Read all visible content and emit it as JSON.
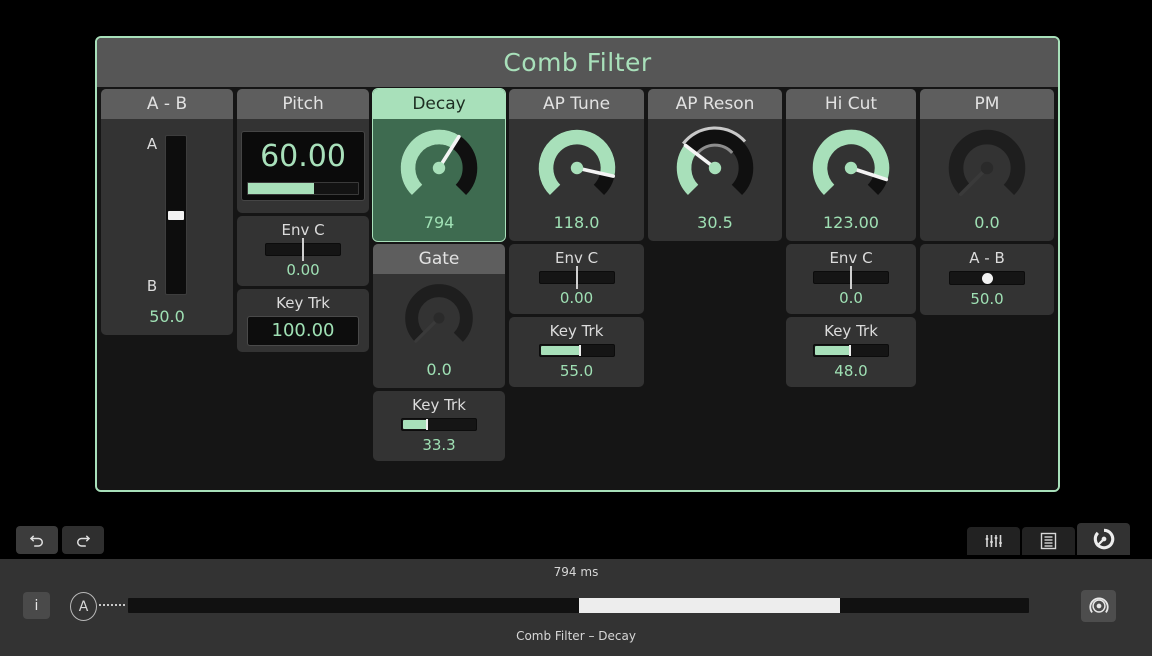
{
  "window": {
    "title": "Comb Filter",
    "accent_color": "#a8e0ba",
    "panel_bg": "#2b2b2b"
  },
  "columns": [
    {
      "id": "a-b",
      "header": "A - B",
      "selected": false,
      "type": "vfader",
      "top_label": "A",
      "bottom_label": "B",
      "value": "50.0",
      "position_pct": 50,
      "subs": []
    },
    {
      "id": "pitch",
      "header": "Pitch",
      "selected": false,
      "type": "display",
      "value": "60.00",
      "bar_pct": 60,
      "subs": [
        {
          "label": "Env C",
          "type": "bipolar",
          "value": "0.00",
          "pct": 50
        },
        {
          "label": "Key Trk",
          "type": "numbox",
          "value": "100.00"
        }
      ]
    },
    {
      "id": "decay",
      "header": "Decay",
      "selected": true,
      "type": "knob",
      "value": "794",
      "knob_pct": 62,
      "mod_pct": null,
      "subs": [
        {
          "label": "Gate",
          "type": "knob_module",
          "value": "0.0",
          "knob_pct": 0
        },
        {
          "label": "Key Trk",
          "type": "bar",
          "value": "33.3",
          "pct": 33.3
        }
      ]
    },
    {
      "id": "ap-tune",
      "header": "AP Tune",
      "selected": false,
      "type": "knob",
      "value": "118.0",
      "knob_pct": 88,
      "mod_pct": null,
      "subs": [
        {
          "label": "Env C",
          "type": "bipolar",
          "value": "0.00",
          "pct": 50
        },
        {
          "label": "Key Trk",
          "type": "bar",
          "value": "55.0",
          "pct": 55
        }
      ]
    },
    {
      "id": "ap-reson",
      "header": "AP Reson",
      "selected": false,
      "type": "knob",
      "value": "30.5",
      "knob_pct": 30.5,
      "mod_pct": 68,
      "subs": []
    },
    {
      "id": "hi-cut",
      "header": "Hi Cut",
      "selected": false,
      "type": "knob",
      "value": "123.00",
      "knob_pct": 90,
      "mod_pct": null,
      "subs": [
        {
          "label": "Env C",
          "type": "bipolar",
          "value": "0.0",
          "pct": 50
        },
        {
          "label": "Key Trk",
          "type": "bar",
          "value": "48.0",
          "pct": 48
        }
      ]
    },
    {
      "id": "pm",
      "header": "PM",
      "selected": false,
      "type": "knob",
      "value": "0.0",
      "knob_pct": 0,
      "knob_dark": true,
      "knob_center": true,
      "mod_pct": null,
      "subs": [
        {
          "label": "A - B",
          "type": "dot",
          "value": "50.0",
          "pct": 50
        }
      ]
    }
  ],
  "toolbar": {
    "undo_icon": "undo-arrow-icon",
    "redo_icon": "redo-arrow-icon",
    "tabs": [
      {
        "id": "mixer",
        "icon": "sliders-icon",
        "active": false
      },
      {
        "id": "list",
        "icon": "list-icon",
        "active": false
      },
      {
        "id": "knobs",
        "icon": "knob-icon",
        "active": true
      }
    ]
  },
  "status": {
    "info_label": "i",
    "source_label": "A",
    "unit_readout": "794 ms",
    "slider_start_pct": 50,
    "slider_end_pct": 79,
    "footer": "Comb Filter  –  Decay",
    "knob_button_icon": "knob-icon"
  }
}
